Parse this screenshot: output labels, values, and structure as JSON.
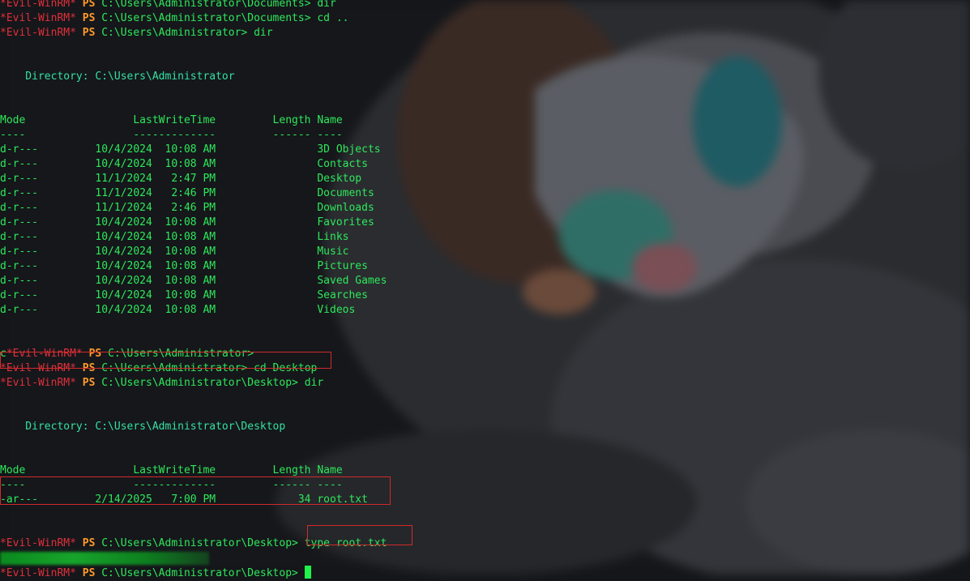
{
  "terminal": {
    "lines": [
      {
        "type": "prompt",
        "name": "*Evil-WinRM*",
        "ps": "PS",
        "path": "C:\\Users\\Administrator\\Documents>",
        "cmd": " dir"
      },
      {
        "type": "prompt",
        "name": "*Evil-WinRM*",
        "ps": "PS",
        "path": "C:\\Users\\Administrator\\Documents>",
        "cmd": " cd .."
      },
      {
        "type": "prompt",
        "name": "*Evil-WinRM*",
        "ps": "PS",
        "path": "C:\\Users\\Administrator>",
        "cmd": " dir"
      },
      {
        "type": "blank"
      },
      {
        "type": "blank"
      },
      {
        "type": "text",
        "cls": "cyan",
        "text": "    Directory: C:\\Users\\Administrator"
      },
      {
        "type": "blank"
      },
      {
        "type": "blank"
      },
      {
        "type": "text",
        "cls": "tbl",
        "text": "Mode                 LastWriteTime         Length Name"
      },
      {
        "type": "text",
        "cls": "tbl",
        "text": "----                 -------------         ------ ----"
      },
      {
        "type": "text",
        "cls": "tbl",
        "text": "d-r---         10/4/2024  10:08 AM                3D Objects"
      },
      {
        "type": "text",
        "cls": "tbl",
        "text": "d-r---         10/4/2024  10:08 AM                Contacts"
      },
      {
        "type": "text",
        "cls": "tbl",
        "text": "d-r---         11/1/2024   2:47 PM                Desktop"
      },
      {
        "type": "text",
        "cls": "tbl",
        "text": "d-r---         11/1/2024   2:46 PM                Documents"
      },
      {
        "type": "text",
        "cls": "tbl",
        "text": "d-r---         11/1/2024   2:46 PM                Downloads"
      },
      {
        "type": "text",
        "cls": "tbl",
        "text": "d-r---         10/4/2024  10:08 AM                Favorites"
      },
      {
        "type": "text",
        "cls": "tbl",
        "text": "d-r---         10/4/2024  10:08 AM                Links"
      },
      {
        "type": "text",
        "cls": "tbl",
        "text": "d-r---         10/4/2024  10:08 AM                Music"
      },
      {
        "type": "text",
        "cls": "tbl",
        "text": "d-r---         10/4/2024  10:08 AM                Pictures"
      },
      {
        "type": "text",
        "cls": "tbl",
        "text": "d-r---         10/4/2024  10:08 AM                Saved Games"
      },
      {
        "type": "text",
        "cls": "tbl",
        "text": "d-r---         10/4/2024  10:08 AM                Searches"
      },
      {
        "type": "text",
        "cls": "tbl",
        "text": "d-r---         10/4/2024  10:08 AM                Videos"
      },
      {
        "type": "blank"
      },
      {
        "type": "blank"
      },
      {
        "type": "prompt",
        "lead": "c",
        "name": "*Evil-WinRM*",
        "ps": "PS",
        "path": "C:\\Users\\Administrator>",
        "cmd": ""
      },
      {
        "type": "prompt",
        "name": "*Evil-WinRM*",
        "ps": "PS",
        "path": "C:\\Users\\Administrator>",
        "cmd": " cd Desktop"
      },
      {
        "type": "prompt",
        "name": "*Evil-WinRM*",
        "ps": "PS",
        "path": "C:\\Users\\Administrator\\Desktop>",
        "cmd": " dir"
      },
      {
        "type": "blank"
      },
      {
        "type": "blank"
      },
      {
        "type": "text",
        "cls": "cyan",
        "text": "    Directory: C:\\Users\\Administrator\\Desktop"
      },
      {
        "type": "blank"
      },
      {
        "type": "blank"
      },
      {
        "type": "text",
        "cls": "tbl",
        "text": "Mode                 LastWriteTime         Length Name"
      },
      {
        "type": "text",
        "cls": "tbl",
        "text": "----                 -------------         ------ ----"
      },
      {
        "type": "text",
        "cls": "tbl",
        "text": "-ar---         2/14/2025   7:00 PM             34 root.txt"
      },
      {
        "type": "blank"
      },
      {
        "type": "blank"
      },
      {
        "type": "prompt",
        "name": "*Evil-WinRM*",
        "ps": "PS",
        "path": "C:\\Users\\Administrator\\Desktop>",
        "cmd": " type root.txt"
      },
      {
        "type": "redacted"
      },
      {
        "type": "prompt",
        "name": "*Evil-WinRM*",
        "ps": "PS",
        "path": "C:\\Users\\Administrator\\Desktop>",
        "cmd": " ",
        "cursor": true
      }
    ]
  },
  "colors": {
    "prompt_name": "#e0303a",
    "prompt_ps": "#ff9a2a",
    "text_green": "#2ee85a",
    "highlight_red": "#d32a2a"
  }
}
